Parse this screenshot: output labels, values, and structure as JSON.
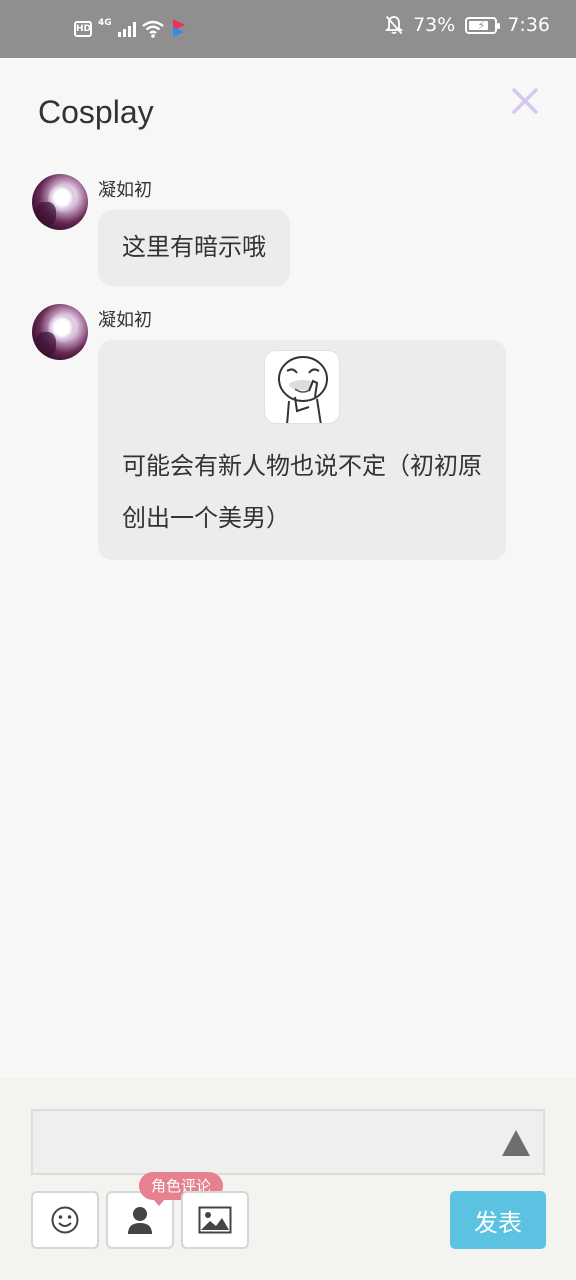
{
  "status_bar": {
    "hd": "HD",
    "network": "4G",
    "battery_percent": "73%",
    "time": "7:36",
    "icons": [
      "hd-icon",
      "signal-icon",
      "wifi-icon",
      "app-notification-icon",
      "mute-bell-icon",
      "battery-charging-icon"
    ]
  },
  "header": {
    "title": "Cosplay",
    "close_icon": "close-icon",
    "accent_color": "#d8c7ee"
  },
  "messages": [
    {
      "username": "凝如初",
      "text": "这里有暗示哦"
    },
    {
      "username": "凝如初",
      "sticker": "meme-face-sticker",
      "text": "可能会有新人物也说不定（初初原创出一个美男）"
    }
  ],
  "composer": {
    "input_value": "",
    "input_placeholder": "",
    "role_tag": "角色评论",
    "publish_label": "发表",
    "publish_color": "#5bc3e1",
    "role_tag_color": "#e6818f",
    "tools": [
      "emoji-icon",
      "person-icon",
      "image-icon"
    ]
  }
}
